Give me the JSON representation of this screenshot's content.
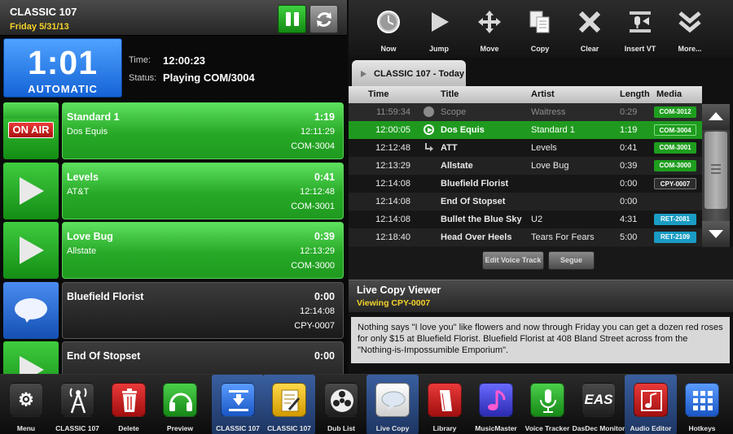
{
  "station": {
    "name": "CLASSIC 107",
    "date": "Friday 5/31/13"
  },
  "clock": {
    "time": "1:01",
    "mode": "AUTOMATIC"
  },
  "status": {
    "time_label": "Time:",
    "time_value": "12:00:23",
    "status_label": "Status:",
    "status_value": "Playing COM/3004"
  },
  "log_items": [
    {
      "title": "Standard 1",
      "duration": "1:19",
      "artist": "Dos Equis",
      "start": "12:11:29",
      "media": "COM-3004",
      "badge": "ON AIR"
    },
    {
      "title": "Levels",
      "duration": "0:41",
      "artist": "AT&T",
      "start": "12:12:48",
      "media": "COM-3001"
    },
    {
      "title": "Love Bug",
      "duration": "0:39",
      "artist": "Allstate",
      "start": "12:13:29",
      "media": "COM-3000"
    },
    {
      "title": "Bluefield Florist",
      "duration": "0:00",
      "artist": "",
      "start": "12:14:08",
      "media": "CPY-0007"
    },
    {
      "title": "End Of Stopset",
      "duration": "0:00",
      "artist": "",
      "start": "",
      "media": ""
    }
  ],
  "toolbar": {
    "items": [
      {
        "label": "Now",
        "icon": "clock-icon"
      },
      {
        "label": "Jump",
        "icon": "play-icon"
      },
      {
        "label": "Move",
        "icon": "move-arrows-icon"
      },
      {
        "label": "Copy",
        "icon": "copy-icon"
      },
      {
        "label": "Clear",
        "icon": "close-icon"
      },
      {
        "label": "Insert VT",
        "icon": "microphone-icon"
      },
      {
        "label": "More...",
        "icon": "chevron-double-down-icon"
      }
    ]
  },
  "tab": {
    "label": "CLASSIC 107 - Today"
  },
  "grid": {
    "headers": {
      "time": "Time",
      "title": "Title",
      "artist": "Artist",
      "length": "Length",
      "media": "Media"
    },
    "rows": [
      {
        "time": "11:59:34",
        "title": "Scope",
        "artist": "Waitress",
        "length": "0:29",
        "media": "COM-3012",
        "state": "played",
        "media_color": "#1e9e1e"
      },
      {
        "time": "12:00:05",
        "title": "Dos Equis",
        "artist": "Standard 1",
        "length": "1:19",
        "media": "COM-3004",
        "state": "playing",
        "media_color": "#1e9e1e"
      },
      {
        "time": "12:12:48",
        "title": "ATT",
        "artist": "Levels",
        "length": "0:41",
        "media": "COM-3001",
        "state": "segue",
        "media_color": "#1e9e1e"
      },
      {
        "time": "12:13:29",
        "title": "Allstate",
        "artist": "Love Bug",
        "length": "0:39",
        "media": "COM-3000",
        "state": "",
        "media_color": "#1e9e1e"
      },
      {
        "time": "12:14:08",
        "title": "Bluefield Florist",
        "artist": "",
        "length": "0:00",
        "media": "CPY-0007",
        "state": "",
        "media_color": "#2c2c2c"
      },
      {
        "time": "12:14:08",
        "title": "End Of Stopset",
        "artist": "",
        "length": "0:00",
        "media": "",
        "state": "",
        "media_color": ""
      },
      {
        "time": "12:14:08",
        "title": "Bullet the Blue Sky",
        "artist": "U2",
        "length": "4:31",
        "media": "RET-2081",
        "state": "",
        "media_color": "#1a9cc4"
      },
      {
        "time": "12:18:40",
        "title": "Head Over Heels",
        "artist": "Tears For Fears",
        "length": "5:00",
        "media": "RET-2109",
        "state": "",
        "media_color": "#1a9cc4"
      }
    ]
  },
  "actions": {
    "edit_vt": "Edit Voice Track",
    "segue": "Segue"
  },
  "live_copy": {
    "title": "Live Copy Viewer",
    "subtitle": "Viewing CPY-0007",
    "text": "Nothing says \"I love you\" like flowers and now through Friday you can get a dozen red roses for only $15 at Bluefield Florist. Bluefield Florist at 408 Bland Street across from the \"Nothing-is-Impossumible Emporium\"."
  },
  "dock": [
    {
      "label": "Menu",
      "icon": "gears-icon",
      "color": "#3a3a3a",
      "selected": false
    },
    {
      "label": "CLASSIC 107",
      "icon": "antenna-icon",
      "color": "#3a3a3a",
      "selected": false
    },
    {
      "label": "Delete",
      "icon": "trash-icon",
      "color": "#c92020",
      "selected": false
    },
    {
      "label": "Preview",
      "icon": "headphones-icon",
      "color": "#22a022",
      "selected": false
    },
    {
      "label": "CLASSIC 107",
      "icon": "log-import-icon",
      "color": "#2f6fd6",
      "selected": true
    },
    {
      "label": "CLASSIC 107",
      "icon": "log-edit-icon",
      "color": "#e2b81a",
      "selected": true
    },
    {
      "label": "Dub List",
      "icon": "reel-icon",
      "color": "#3a3a3a",
      "selected": false
    },
    {
      "label": "Live Copy",
      "icon": "speech-bubble-icon",
      "color": "#eeeeee",
      "selected": true
    },
    {
      "label": "Library",
      "icon": "library-icon",
      "color": "#c92020",
      "selected": false
    },
    {
      "label": "MusicMaster",
      "icon": "music-note-icon",
      "color": "#4a4ad0",
      "selected": false
    },
    {
      "label": "Voice Tracker",
      "icon": "microphone-icon",
      "color": "#22a022",
      "selected": false
    },
    {
      "label": "DasDec Monitor",
      "icon": "eas-icon",
      "glyph": "EAS",
      "color": "#3a3a3a",
      "selected": false
    },
    {
      "label": "Audio Editor",
      "icon": "audio-editor-icon",
      "color": "#c92020",
      "selected": true
    },
    {
      "label": "Hotkeys",
      "icon": "grid-icon",
      "color": "#2f6fd6",
      "selected": false
    }
  ]
}
